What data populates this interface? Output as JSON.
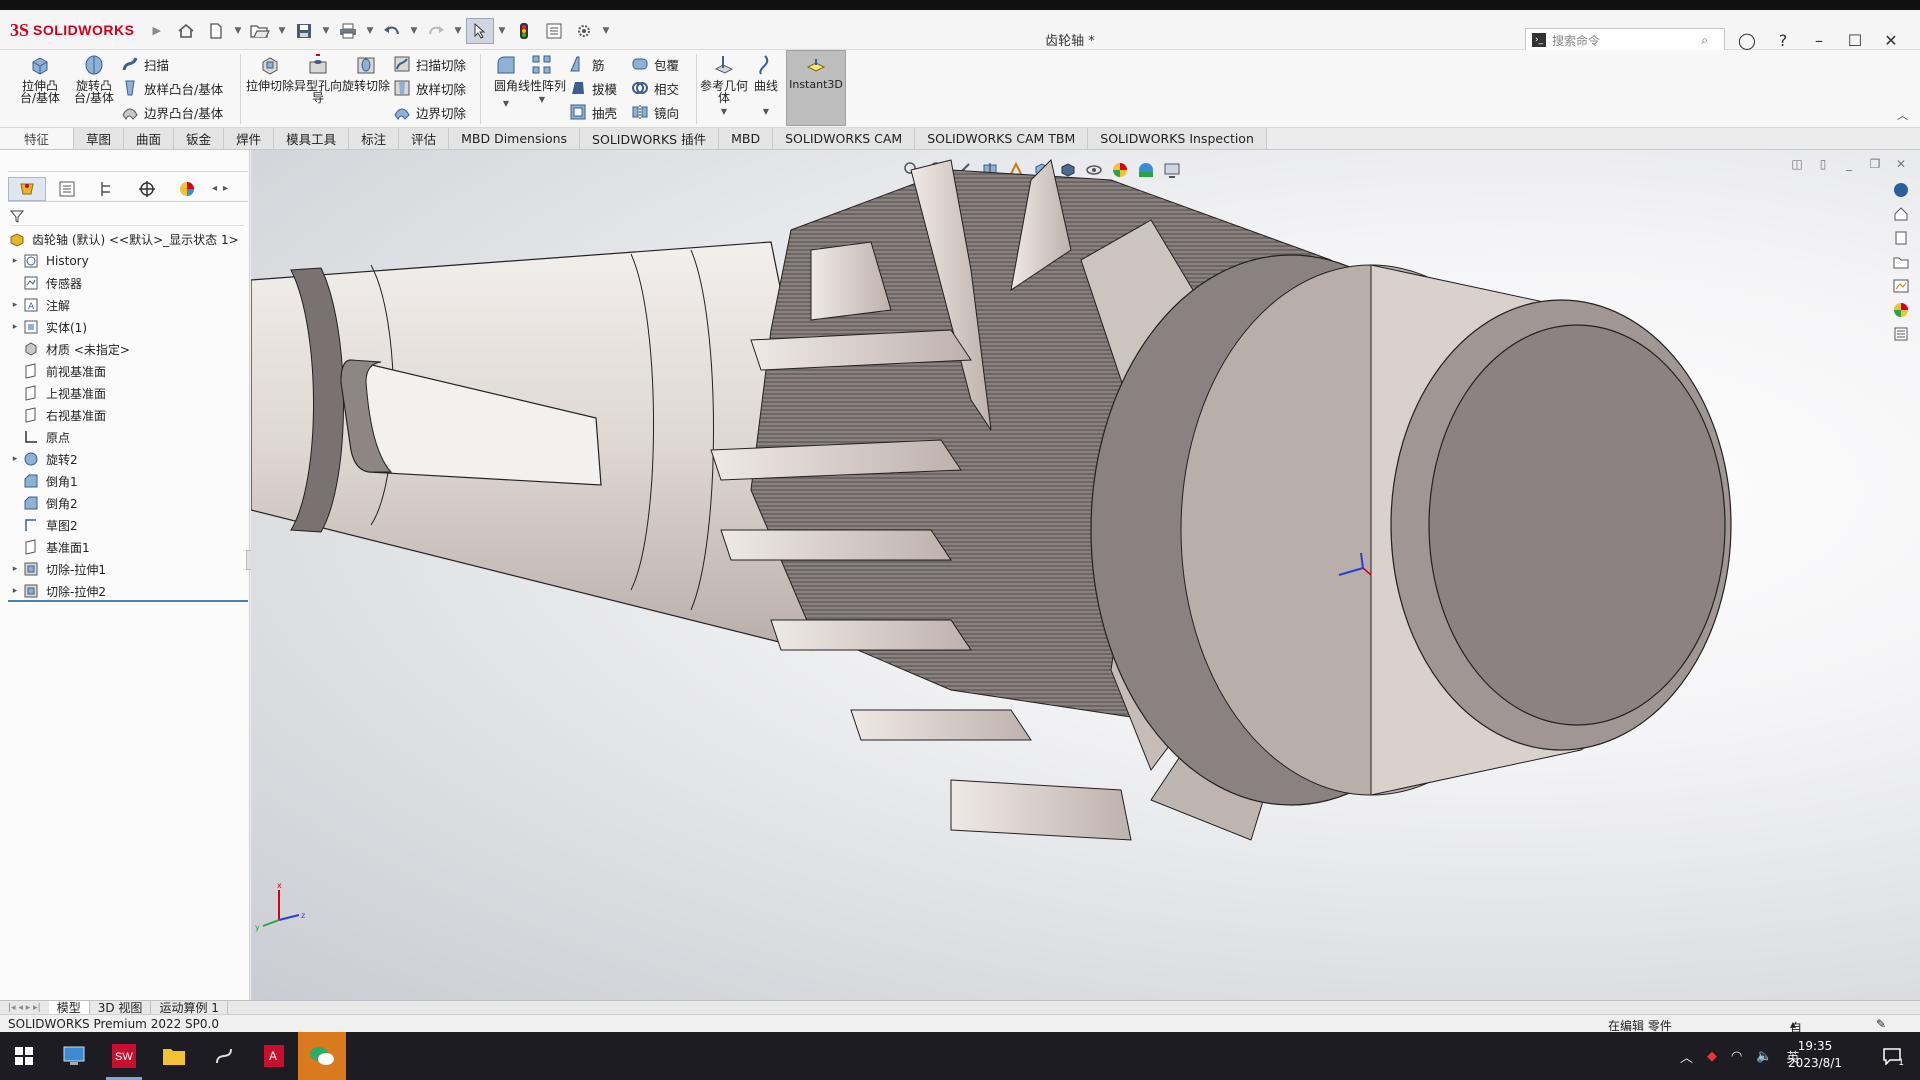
{
  "app": {
    "name": "SOLIDWORKS",
    "doc_title": "齿轮轴 *"
  },
  "search": {
    "placeholder": "搜索命令"
  },
  "ribbon": {
    "extrude_boss": "拉伸凸台/基体",
    "revolve_boss": "旋转凸台/基体",
    "sweep": "扫描",
    "loft_boss": "放样凸台/基体",
    "boundary_boss": "边界凸台/基体",
    "extrude_cut": "拉伸切除",
    "hole_wizard": "异型孔向导",
    "revolve_cut": "旋转切除",
    "swept_cut": "扫描切除",
    "lofted_cut": "放样切除",
    "boundary_cut": "边界切除",
    "fillet": "圆角",
    "linear_pattern": "线性阵列",
    "rib": "筋",
    "draft": "拔模",
    "shell": "抽壳",
    "wrap": "包覆",
    "intersect": "相交",
    "mirror": "镜向",
    "ref_geometry": "参考几何体",
    "curves": "曲线",
    "instant3d": "Instant3D"
  },
  "tabs": [
    "特征",
    "草图",
    "曲面",
    "钣金",
    "焊件",
    "模具工具",
    "标注",
    "评估",
    "MBD Dimensions",
    "SOLIDWORKS 插件",
    "MBD",
    "SOLIDWORKS CAM",
    "SOLIDWORKS CAM TBM",
    "SOLIDWORKS Inspection"
  ],
  "tree": {
    "root": "齿轮轴 (默认) <<默认>_显示状态 1>",
    "items": [
      {
        "label": "History",
        "expandable": true,
        "icon": "history-icon"
      },
      {
        "label": "传感器",
        "expandable": false,
        "icon": "sensor-icon"
      },
      {
        "label": "注解",
        "expandable": true,
        "icon": "annotation-icon"
      },
      {
        "label": "实体(1)",
        "expandable": true,
        "icon": "solid-bodies-icon"
      },
      {
        "label": "材质 <未指定>",
        "expandable": false,
        "icon": "material-icon"
      },
      {
        "label": "前视基准面",
        "expandable": false,
        "icon": "plane-icon"
      },
      {
        "label": "上视基准面",
        "expandable": false,
        "icon": "plane-icon"
      },
      {
        "label": "右视基准面",
        "expandable": false,
        "icon": "plane-icon"
      },
      {
        "label": "原点",
        "expandable": false,
        "icon": "origin-icon"
      },
      {
        "label": "旋转2",
        "expandable": true,
        "icon": "revolve-icon"
      },
      {
        "label": "倒角1",
        "expandable": false,
        "icon": "chamfer-icon"
      },
      {
        "label": "倒角2",
        "expandable": false,
        "icon": "chamfer-icon"
      },
      {
        "label": "草图2",
        "expandable": false,
        "icon": "sketch-icon"
      },
      {
        "label": "基准面1",
        "expandable": false,
        "icon": "plane-icon"
      },
      {
        "label": "切除-拉伸1",
        "expandable": true,
        "icon": "cut-extrude-icon"
      },
      {
        "label": "切除-拉伸2",
        "expandable": true,
        "icon": "cut-extrude-icon"
      }
    ]
  },
  "bottom_tabs": [
    "模型",
    "3D 视图",
    "运动算例 1"
  ],
  "status": {
    "version": "SOLIDWORKS Premium 2022 SP0.0",
    "editing": "在编辑 零件",
    "units": "自定义"
  },
  "taskbar": {
    "ime": "英",
    "time": "19:35",
    "date": "2023/8/1",
    "notifications": "1"
  },
  "triad": {
    "x": "x",
    "y": "y",
    "z": "z"
  }
}
